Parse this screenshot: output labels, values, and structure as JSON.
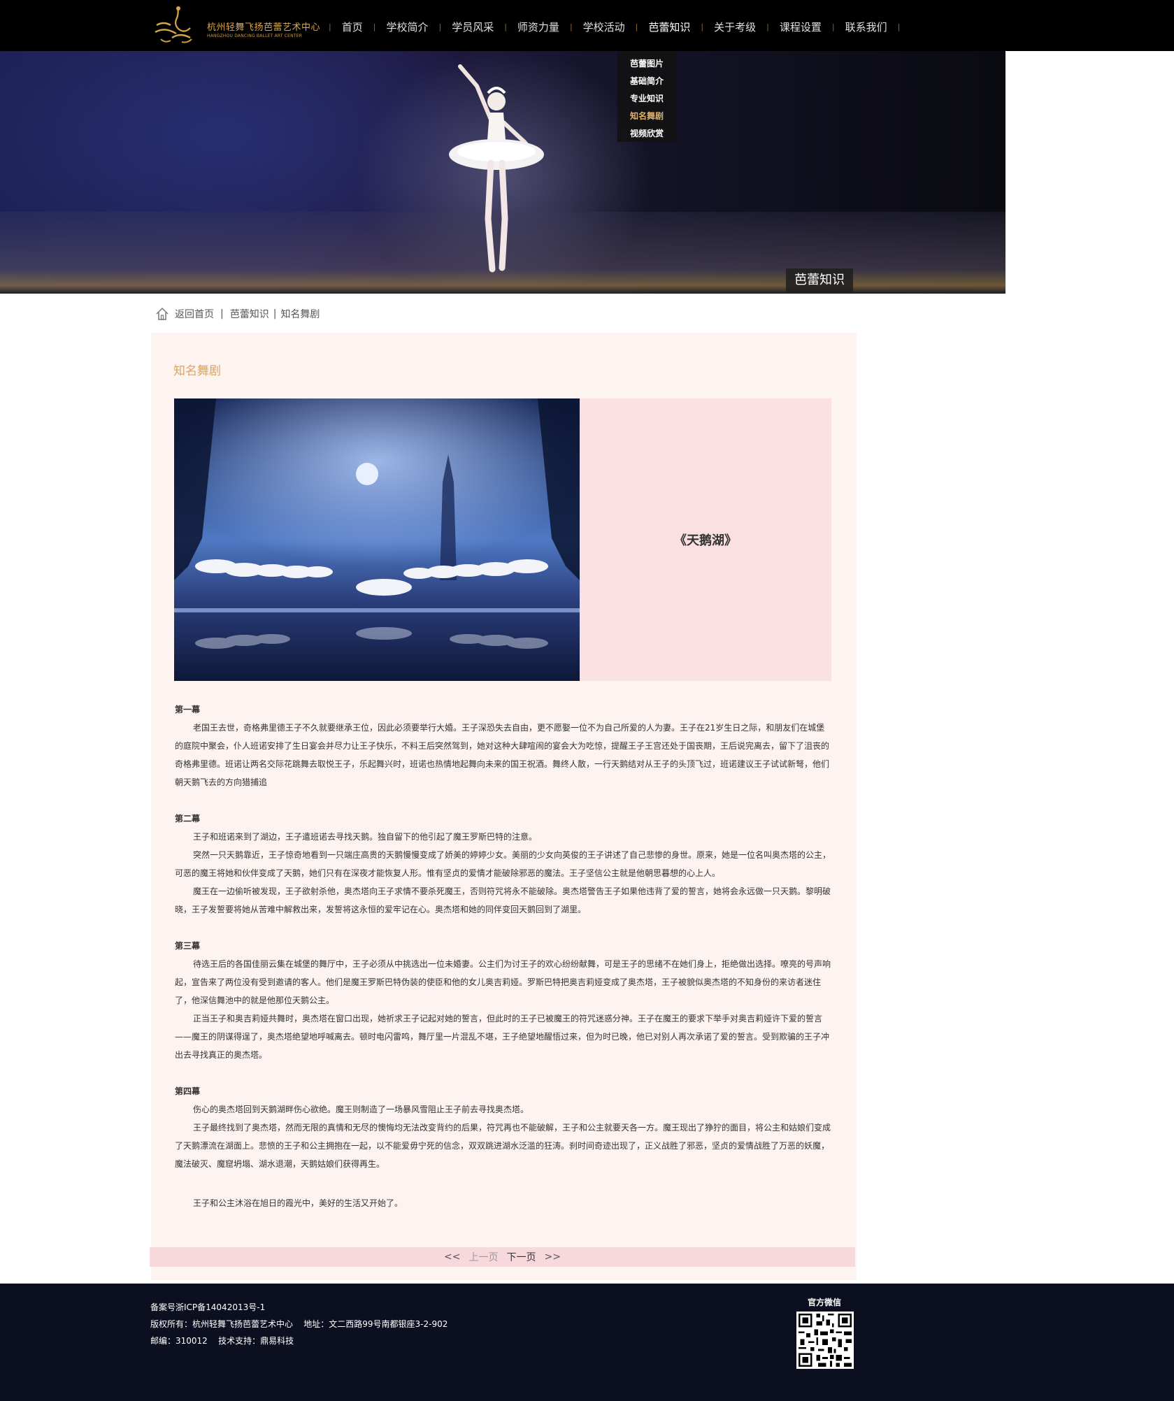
{
  "header": {
    "logo": {
      "cn": "杭州轻舞飞扬芭蕾艺术中心",
      "en": "HANGZHOU DANCING BALLET ART CENTER",
      "mark": "轻舞飞扬"
    },
    "nav": [
      {
        "label": "首页"
      },
      {
        "label": "学校简介"
      },
      {
        "label": "学员风采"
      },
      {
        "label": "师资力量"
      },
      {
        "label": "学校活动"
      },
      {
        "label": "芭蕾知识"
      },
      {
        "label": "关于考级"
      },
      {
        "label": "课程设置"
      },
      {
        "label": "联系我们"
      }
    ],
    "dropdown": [
      {
        "label": "芭蕾图片"
      },
      {
        "label": "基础简介"
      },
      {
        "label": "专业知识"
      },
      {
        "label": "知名舞剧"
      },
      {
        "label": "视频欣赏"
      }
    ]
  },
  "banner": {
    "label": "芭蕾知识"
  },
  "breadcrumb": {
    "home": "返回首页",
    "sep": "|",
    "level1": "芭蕾知识",
    "level2": "知名舞剧"
  },
  "content": {
    "section_title": "知名舞剧",
    "feature_caption": "《天鹅湖》",
    "act1": {
      "title": "第一幕",
      "p1": "老国王去世，奇格弗里德王子不久就要继承王位，因此必须要举行大婚。王子深恐失去自由，更不愿娶一位不为自己所爱的人为妻。王子在21岁生日之际，和朋友们在城堡的庭院中聚会，仆人班诺安排了生日宴会并尽力让王子快乐，不料王后突然驾到，她对这种大肆喧闹的宴会大为吃惊，提醒王子王宫还处于国丧期，王后说完离去，留下了沮丧的奇格弗里德。班诺让两名交际花跳舞去取悦王子，乐起舞兴时，班诺也热情地起舞向未来的国王祝酒。舞终人散，一行天鹅结对从王子的头顶飞过，班诺建议王子试试新弩，他们朝天鹅飞去的方向猎捕追"
    },
    "act2": {
      "title": "第二幕",
      "p1": "王子和班诺来到了湖边，王子遣班诺去寻找天鹅。独自留下的他引起了魔王罗斯巴特的注意。",
      "p2": "突然一只天鹅靠近，王子惊奇地看到一只端庄高贵的天鹅慢慢变成了娇美的婷婷少女。美丽的少女向英俊的王子讲述了自己悲惨的身世。原来，她是一位名叫奥杰塔的公主，可恶的魔王将她和伙伴变成了天鹅，她们只有在深夜才能恢复人形。惟有坚贞的爱情才能破除邪恶的魔法。王子坚信公主就是他朝思暮想的心上人。",
      "p3": "魔王在一边偷听被发现，王子欲射杀他，奥杰塔向王子求情不要杀死魔王，否则符咒将永不能破除。奥杰塔警告王子如果他违背了爱的誓言，她将会永远做一只天鹅。黎明破晓，王子发誓要将她从苦难中解救出来，发誓将这永恒的爱牢记在心。奥杰塔和她的同伴变回天鹅回到了湖里。"
    },
    "act3": {
      "title": "第三幕",
      "p1": "待选王后的各国佳丽云集在城堡的舞厅中，王子必须从中挑选出一位未婚妻。公主们为讨王子的欢心纷纷献舞，可是王子的思绪不在她们身上，拒绝做出选择。嘹亮的号声响起，宣告来了两位没有受到邀请的客人。他们是魔王罗斯巴特伪装的使臣和他的女儿奥吉莉娅。罗斯巴特把奥吉莉娅变成了奥杰塔，王子被貌似奥杰塔的不知身份的来访者迷住了，他深信舞池中的就是他那位天鹅公主。",
      "p2": "正当王子和奥吉莉娅共舞时，奥杰塔在窗口出现，她祈求王子记起对她的誓言，但此时的王子已被魔王的符咒迷惑分神。王子在魔王的要求下举手对奥吉莉娅许下爱的誓言——魔王的阴谋得逞了，奥杰塔绝望地呼喊离去。顿时电闪雷鸣，舞厅里一片混乱不堪，王子绝望地醒悟过来，但为时已晚，他已对别人再次承诺了爱的誓言。受到欺骗的王子冲出去寻找真正的奥杰塔。"
    },
    "act4": {
      "title": "第四幕",
      "p1": "伤心的奥杰塔回到天鹅湖畔伤心欲绝。魔王则制造了一场暴风雪阻止王子前去寻找奥杰塔。",
      "p2": "王子最终找到了奥杰塔，然而无限的真情和无尽的懊悔均无法改变背约的后果，符咒再也不能破解，王子和公主就要天各一方。魔王现出了狰狞的面目，将公主和姑娘们变成了天鹅漂流在湖面上。悲愤的王子和公主拥抱在一起，以不能爱毋宁死的信念，双双跳进湖水泛滥的狂涛。刹时间奇迹出现了，正义战胜了邪恶，坚贞的爱情战胜了万恶的妖魔，魔法破灭、魔窟坍塌、湖水退潮，天鹅姑娘们获得再生。",
      "p3": "王子和公主沐浴在旭日的霞光中，美好的生活又开始了。"
    },
    "pager": {
      "left_arrows": "<<",
      "prev": "上一页",
      "next": "下一页",
      "right_arrows": ">>"
    }
  },
  "footer": {
    "icp": "备案号浙ICP备14042013号-1",
    "copyright": "版权所有：杭州轻舞飞扬芭蕾艺术中心    地址：文二西路99号南都银座3-2-902",
    "postal": "邮编：310012    技术支持：鼎易科技",
    "wechat_label": "官方微信"
  }
}
